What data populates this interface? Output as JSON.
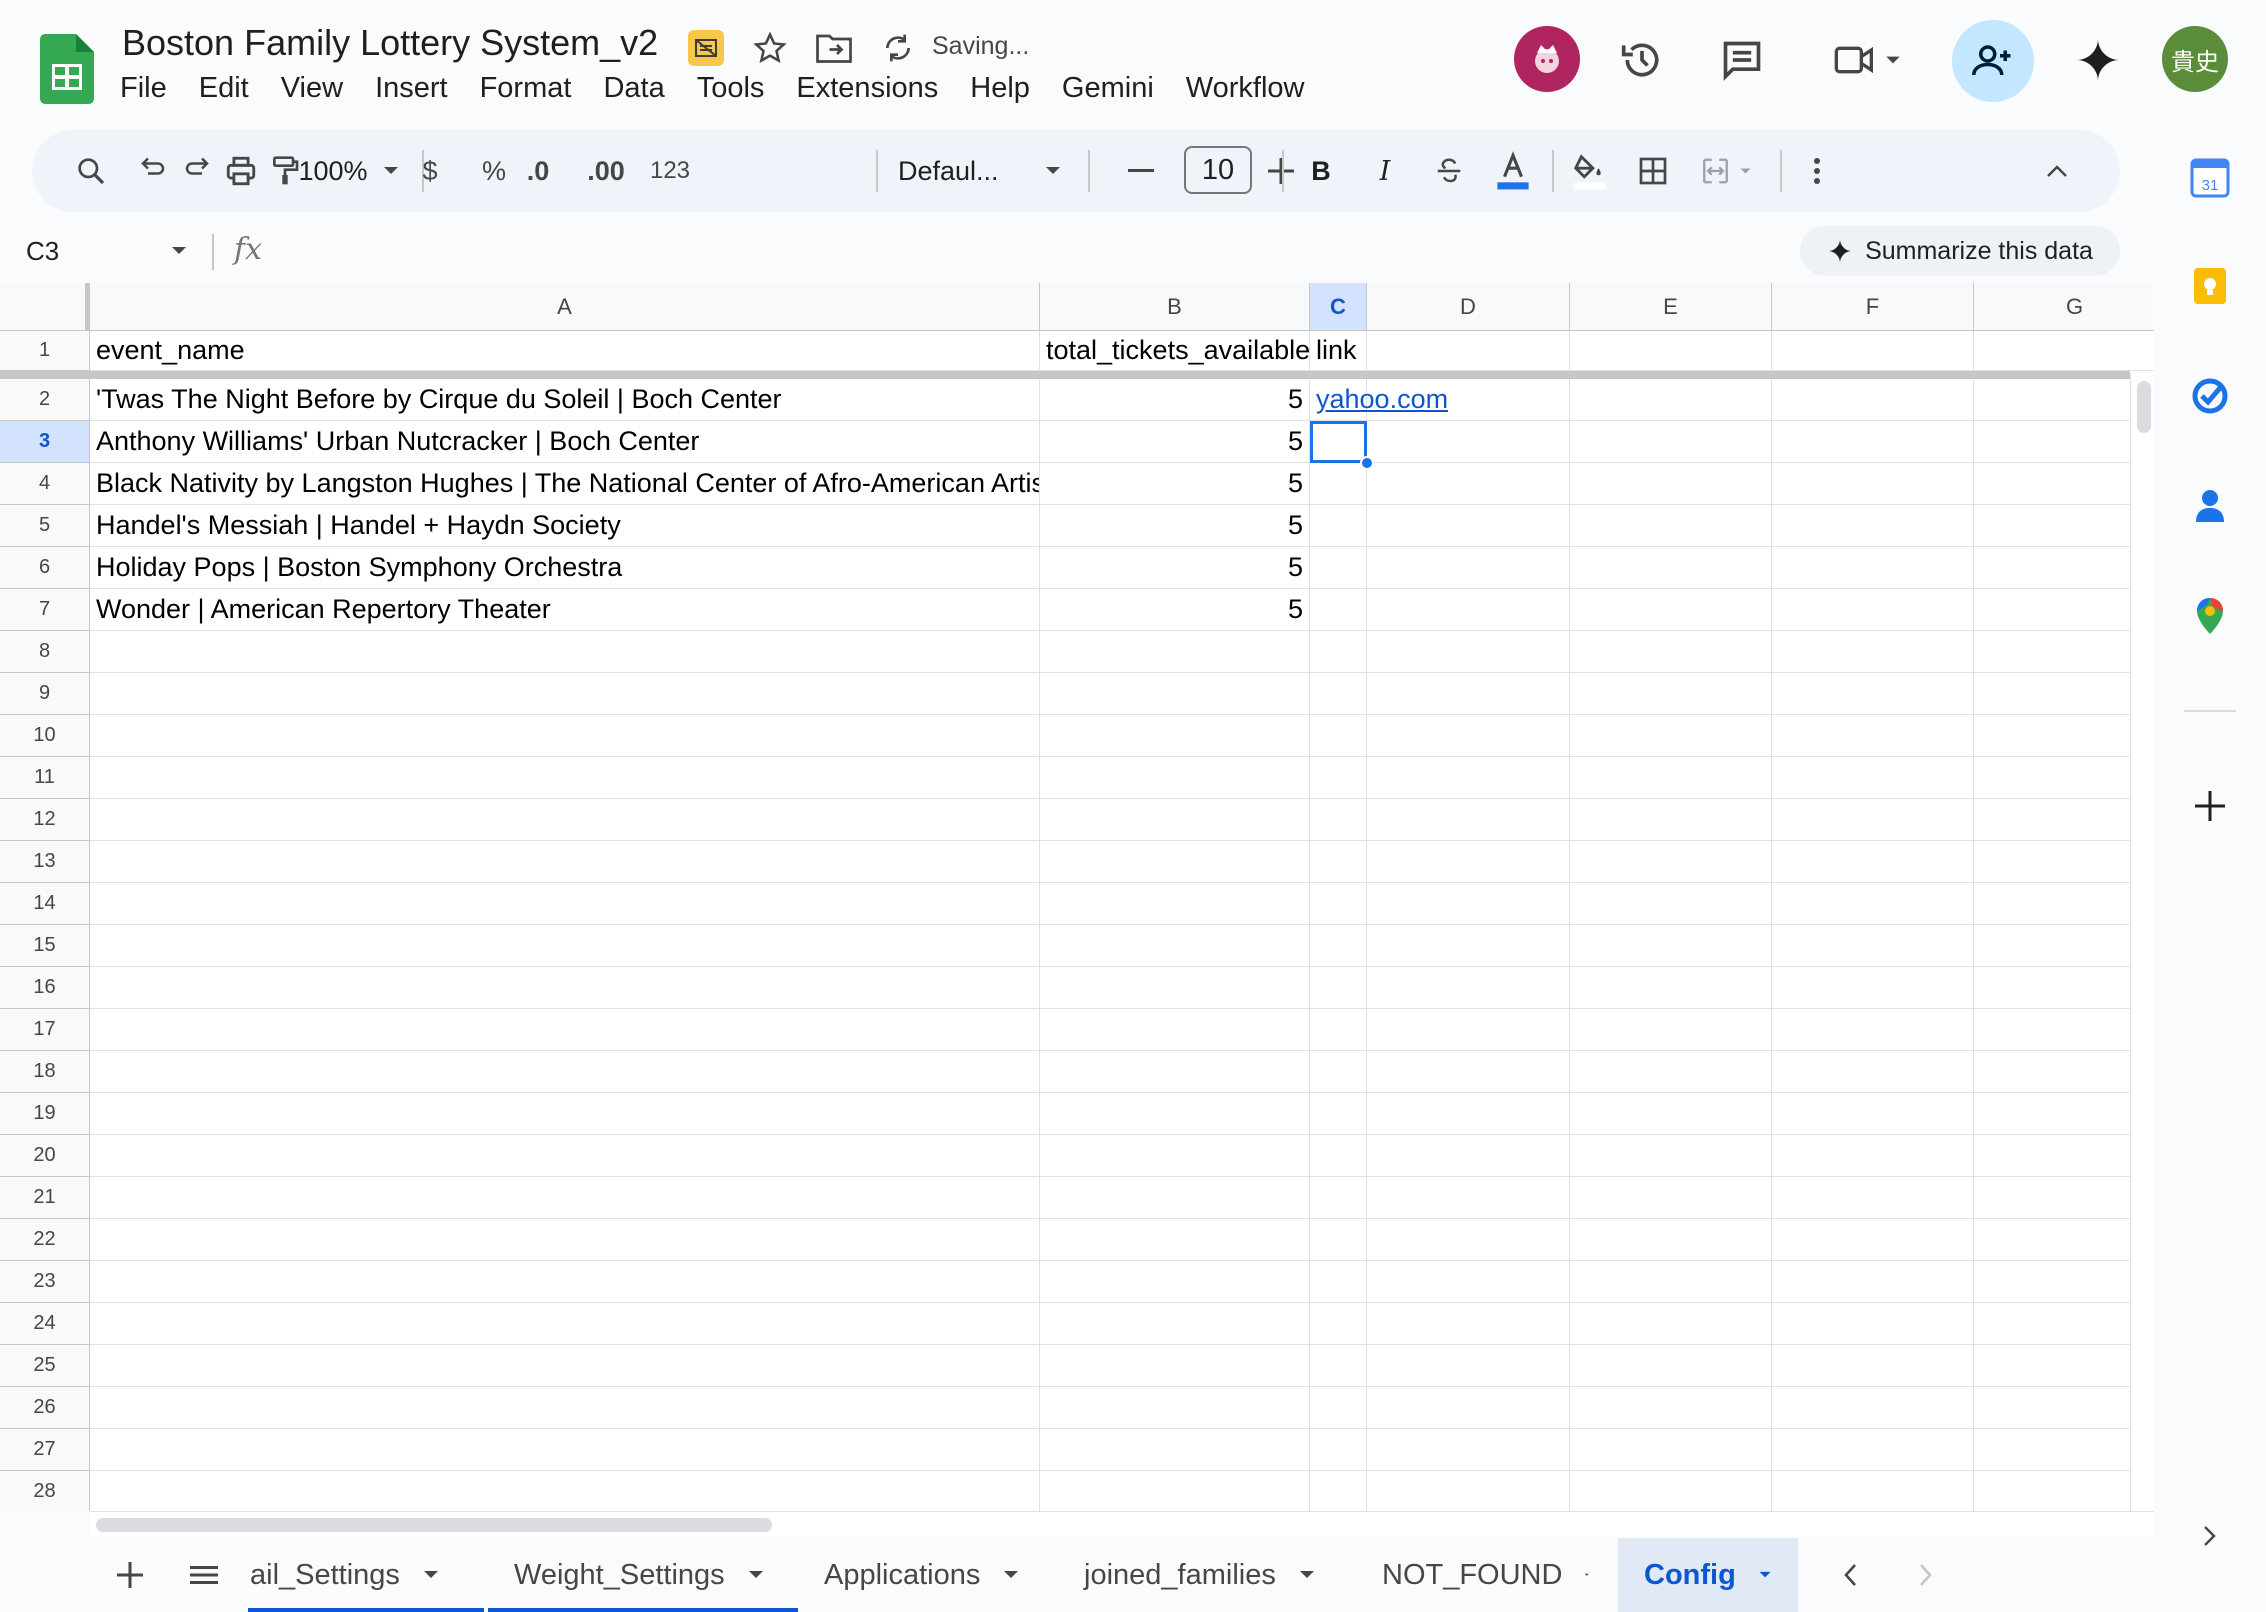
{
  "document": {
    "title": "Boston Family Lottery System_v2",
    "status": "Saving..."
  },
  "menu": [
    "File",
    "Edit",
    "View",
    "Insert",
    "Format",
    "Data",
    "Tools",
    "Extensions",
    "Help",
    "Gemini",
    "Workflow"
  ],
  "user": {
    "initials": "貴史"
  },
  "toolbar": {
    "zoom": "100%",
    "currency": "$",
    "percent": "%",
    "decrease_decimal": ".0",
    "increase_decimal": ".00",
    "number_format": "123",
    "font": "Defaul...",
    "font_size": "10"
  },
  "formula_bar": {
    "cell_ref": "C3",
    "fx": "fx",
    "summarize_label": "Summarize this data"
  },
  "columns": [
    "A",
    "B",
    "C",
    "D",
    "E",
    "F",
    "G"
  ],
  "selected_column": "C",
  "selected_row": 3,
  "rows": [
    {
      "num": "1",
      "a": "event_name",
      "b": "total_tickets_available",
      "c": "link"
    },
    {
      "num": "2",
      "a": "'Twas The Night Before by Cirque du Soleil | Boch Center",
      "b": "5",
      "c": "yahoo.com"
    },
    {
      "num": "3",
      "a": "Anthony Williams' Urban Nutcracker | Boch Center",
      "b": "5",
      "c": ""
    },
    {
      "num": "4",
      "a": "Black Nativity by Langston Hughes | The National Center of Afro-American Artis",
      "b": "5",
      "c": ""
    },
    {
      "num": "5",
      "a": "Handel's Messiah | Handel + Haydn Society",
      "b": "5",
      "c": ""
    },
    {
      "num": "6",
      "a": "Holiday Pops | Boston Symphony Orchestra",
      "b": "5",
      "c": ""
    },
    {
      "num": "7",
      "a": "Wonder | American Repertory Theater",
      "b": "5",
      "c": ""
    }
  ],
  "empty_row_numbers": [
    "8",
    "9",
    "10",
    "11",
    "12",
    "13",
    "14",
    "15",
    "16",
    "17",
    "18",
    "19",
    "20",
    "21",
    "22",
    "23",
    "24",
    "25",
    "26",
    "27",
    "28"
  ],
  "sheets": [
    {
      "label": "ail_Settings"
    },
    {
      "label": "Weight_Settings"
    },
    {
      "label": "Applications"
    },
    {
      "label": "joined_families"
    },
    {
      "label": "NOT_FOUND"
    },
    {
      "label": "Config"
    }
  ],
  "active_sheet": "Config",
  "colors": {
    "accent": "#0b57d0",
    "link": "#1155cc",
    "selection": "#1a73e8",
    "share_button": "#c2e7ff",
    "sheets_green": "#34a853"
  },
  "icons": [
    "sheets-logo-icon",
    "move-to-drive-icon",
    "star-icon",
    "folder-icon",
    "sync-icon",
    "history-icon",
    "comment-icon",
    "meet-icon",
    "add-person-icon",
    "gemini-icon",
    "search-icon",
    "undo-icon",
    "redo-icon",
    "print-icon",
    "paint-format-icon",
    "bold-icon",
    "italic-icon",
    "strikethrough-icon",
    "text-color-icon",
    "fill-color-icon",
    "borders-icon",
    "merge-cells-icon",
    "more-icon",
    "collapse-icon",
    "calendar-icon",
    "keep-icon",
    "tasks-icon",
    "contacts-icon",
    "maps-icon",
    "plus-icon",
    "chevron-right-icon"
  ]
}
